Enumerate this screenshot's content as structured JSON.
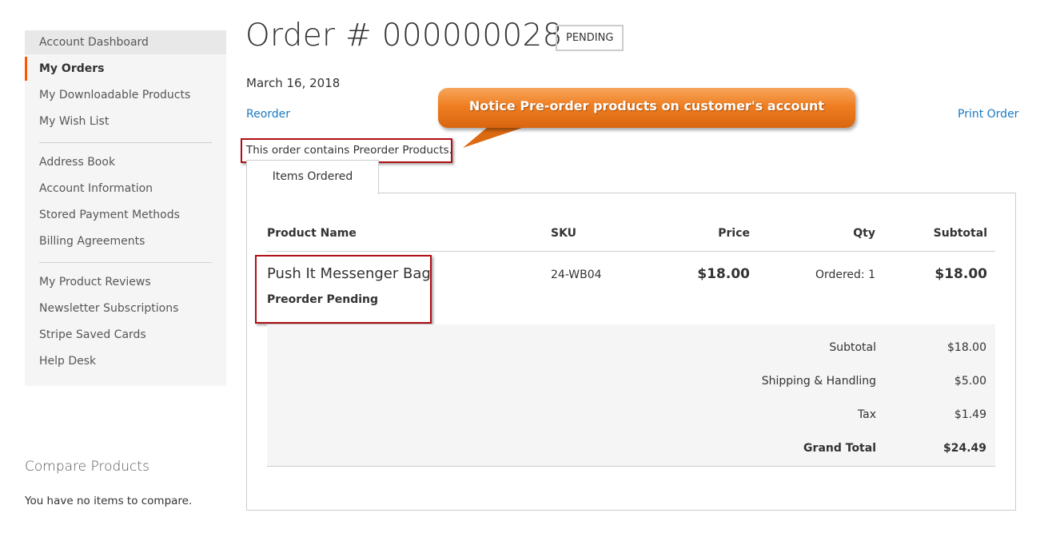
{
  "sidebar": {
    "items": [
      {
        "label": "Account Dashboard"
      },
      {
        "label": "My Orders"
      },
      {
        "label": "My Downloadable Products"
      },
      {
        "label": "My Wish List"
      },
      {
        "label": "Address Book"
      },
      {
        "label": "Account Information"
      },
      {
        "label": "Stored Payment Methods"
      },
      {
        "label": "Billing Agreements"
      },
      {
        "label": "My Product Reviews"
      },
      {
        "label": "Newsletter Subscriptions"
      },
      {
        "label": "Stripe Saved Cards"
      },
      {
        "label": "Help Desk"
      }
    ],
    "active_index": 1,
    "accent_color": "#ff5501"
  },
  "compare": {
    "title": "Compare Products",
    "empty_text": "You have no items to compare."
  },
  "order": {
    "title": "Order # 000000028",
    "status": "PENDING",
    "date": "March 16, 2018",
    "reorder_label": "Reorder",
    "print_label": "Print Order",
    "preorder_note": "This order contains Preorder Products."
  },
  "callout": {
    "text": "Notice Pre-order products on customer's account",
    "color": "#ef7e21"
  },
  "tabs": [
    {
      "label": "Items Ordered"
    }
  ],
  "items_table": {
    "headers": {
      "name": "Product Name",
      "sku": "SKU",
      "price": "Price",
      "qty": "Qty",
      "subtotal": "Subtotal"
    },
    "rows": [
      {
        "name": "Push It Messenger Bag",
        "option": "Preorder Pending",
        "sku": "24-WB04",
        "price": "$18.00",
        "qty": "Ordered: 1",
        "subtotal": "$18.00"
      }
    ]
  },
  "totals": [
    {
      "label": "Subtotal",
      "value": "$18.00"
    },
    {
      "label": "Shipping & Handling",
      "value": "$5.00"
    },
    {
      "label": "Tax",
      "value": "$1.49"
    },
    {
      "label": "Grand Total",
      "value": "$24.49"
    }
  ],
  "link_color": "#1979c3",
  "highlight_border_color": "#b00e14"
}
